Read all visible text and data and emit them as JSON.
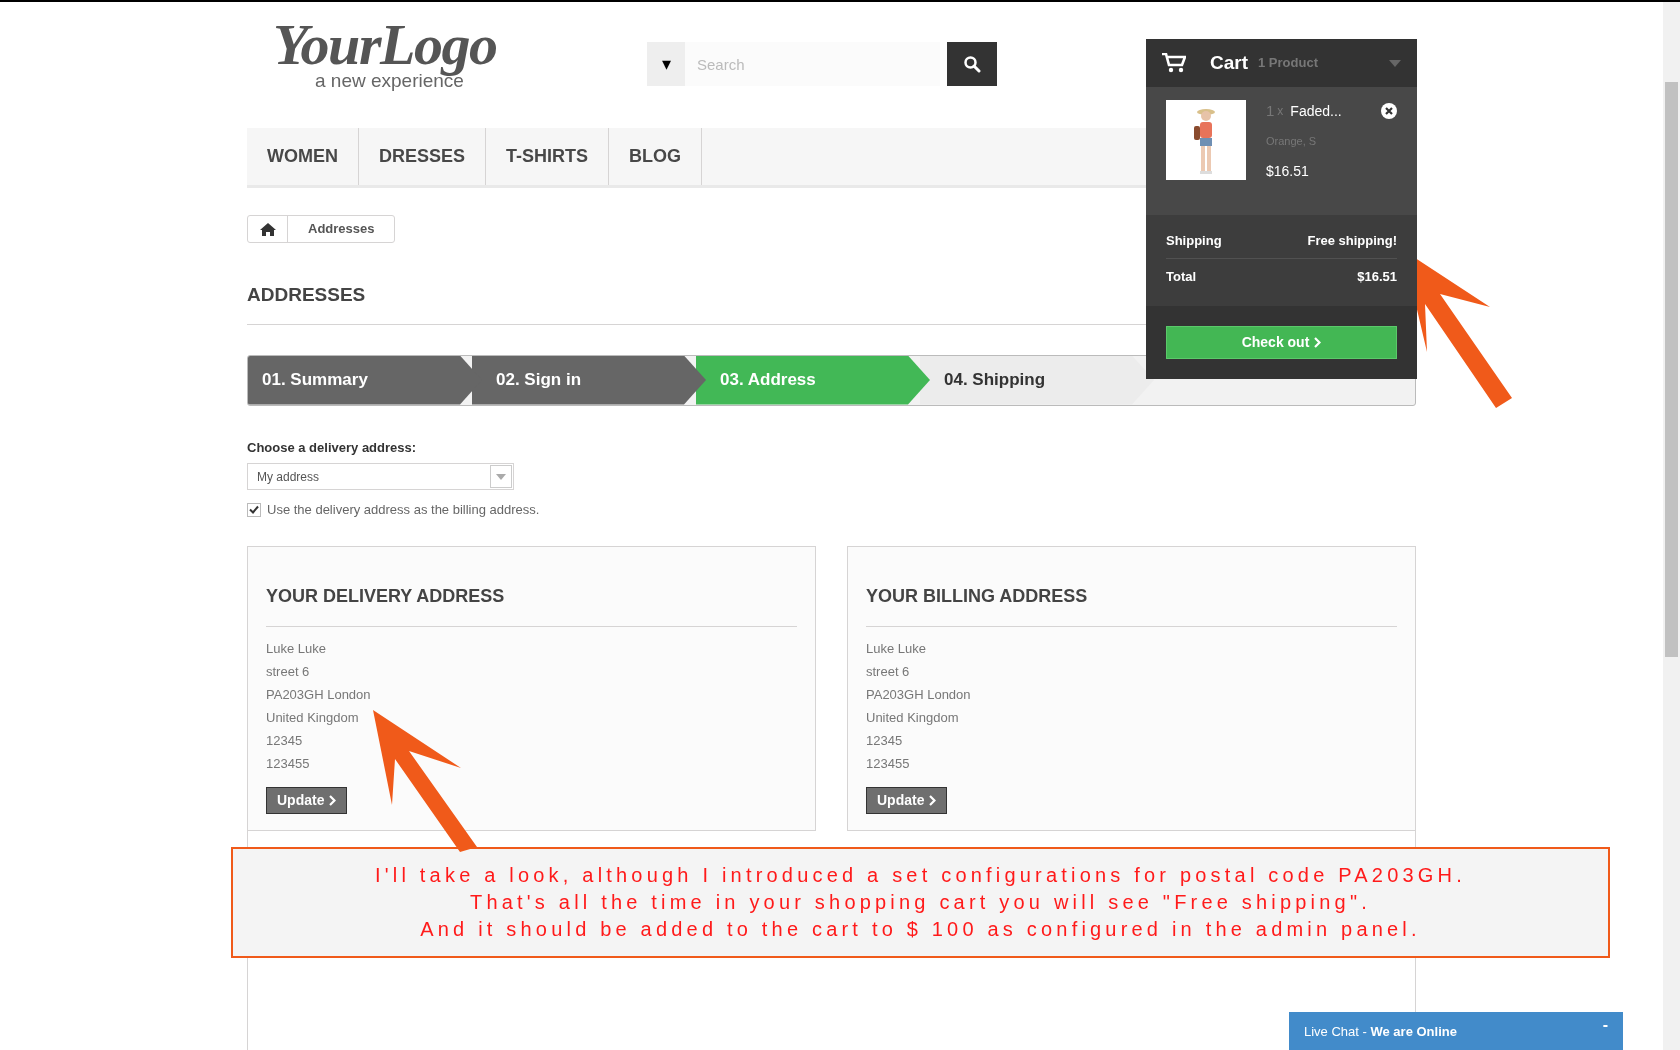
{
  "header": {
    "logo": {
      "title": "YourLogo",
      "tagline": "a new experience"
    },
    "search": {
      "toggle": "▾",
      "placeholder": "Search"
    }
  },
  "nav": [
    {
      "label": "WOMEN"
    },
    {
      "label": "DRESSES"
    },
    {
      "label": "T-SHIRTS"
    },
    {
      "label": "BLOG"
    }
  ],
  "breadcrumb": {
    "current": "Addresses"
  },
  "page_title": "ADDRESSES",
  "steps": [
    {
      "label": "01. Summary",
      "completed": true,
      "selected": false
    },
    {
      "label": "02. Sign in",
      "completed": true,
      "selected": false
    },
    {
      "label": "03. Address",
      "completed": false,
      "selected": true
    },
    {
      "label": "04. Shipping",
      "completed": false,
      "selected": false
    }
  ],
  "delivery": {
    "label": "Choose a delivery address:",
    "value": "My address",
    "same_billing": {
      "label": "Use the delivery address as the billing address.",
      "checked": true
    }
  },
  "addresses": [
    {
      "title": "YOUR DELIVERY ADDRESS",
      "lines": [
        "Luke Luke",
        "street 6",
        "PA203GH London",
        "United Kingdom",
        "12345",
        "123455"
      ],
      "button": "Update"
    },
    {
      "title": "YOUR BILLING ADDRESS",
      "lines": [
        "Luke Luke",
        "street 6",
        "PA203GH London",
        "United Kingdom",
        "12345",
        "123455"
      ],
      "button": "Update"
    }
  ],
  "cart": {
    "title": "Cart",
    "count": "1 Product",
    "item": {
      "quantity": "1",
      "times": "x",
      "name": "Faded...",
      "attributes": "Orange, S",
      "price": "$16.51"
    },
    "rows": [
      {
        "label": "Shipping",
        "value": "Free shipping!"
      },
      {
        "label": "Total",
        "value": "$16.51"
      }
    ],
    "checkout": "Check out"
  },
  "annotation": {
    "lines": [
      "I'll take a look, although I introduced a set configurations for postal code PA203GH.",
      "That's all the time in your shopping cart you will see \"Free shipping\".",
      "And it should be added to the cart to $ 100 as configured in the admin panel."
    ]
  },
  "live_chat": {
    "label": "Live Chat - ",
    "status": "We are Online",
    "minimize": "-"
  }
}
